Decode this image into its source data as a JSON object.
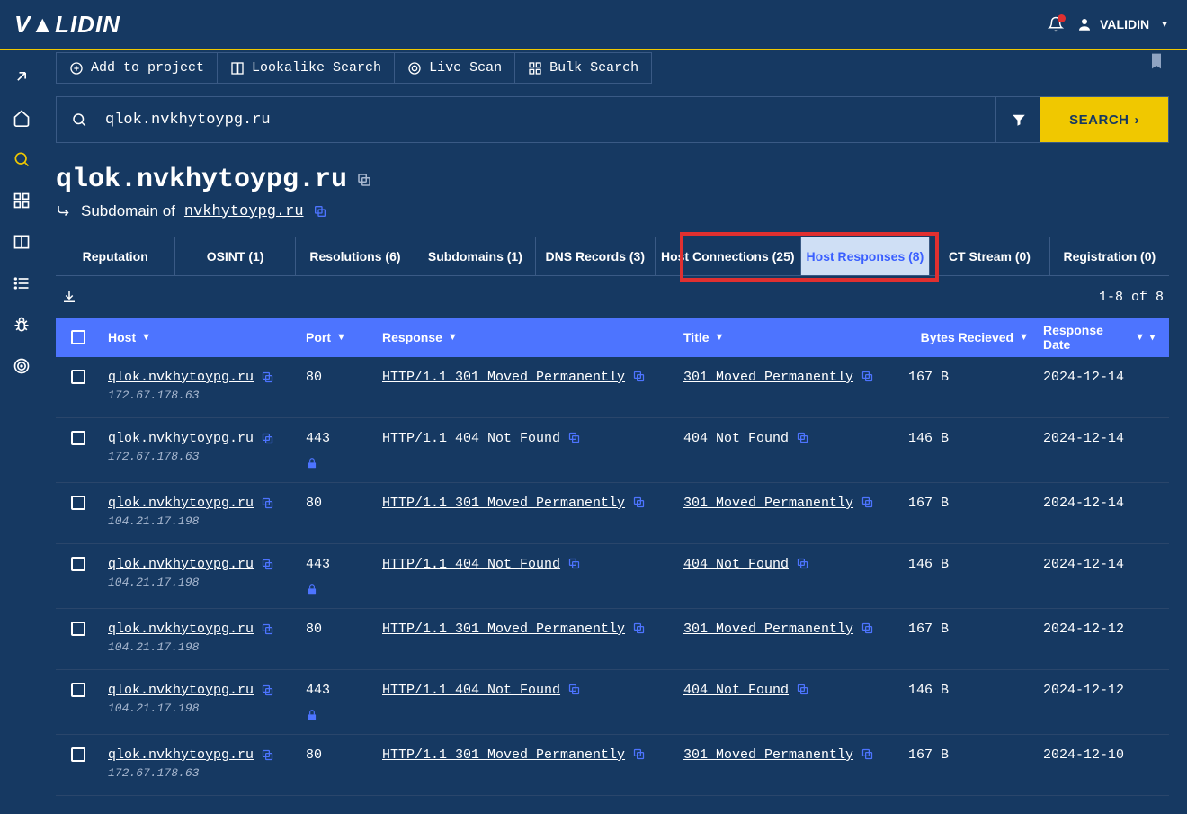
{
  "header": {
    "logo": "V▲LIDIN",
    "user": "VALIDIN"
  },
  "toolbar": {
    "add_to_project": "Add to project",
    "lookalike": "Lookalike Search",
    "live_scan": "Live Scan",
    "bulk_search": "Bulk Search"
  },
  "search": {
    "value": "qlok.nvkhytoypg.ru",
    "button": "SEARCH"
  },
  "title": {
    "host": "qlok.nvkhytoypg.ru",
    "subdomain_prefix": "Subdomain of",
    "parent": "nvkhytoypg.ru"
  },
  "tabs": [
    {
      "label": "Reputation"
    },
    {
      "label": "OSINT (1)"
    },
    {
      "label": "Resolutions (6)"
    },
    {
      "label": "Subdomains (1)"
    },
    {
      "label": "DNS Records (3)"
    },
    {
      "label": "Host Connections (25)"
    },
    {
      "label": "Host Responses (8)"
    },
    {
      "label": "CT Stream (0)"
    },
    {
      "label": "Registration (0)"
    }
  ],
  "pagination": "1-8 of 8",
  "columns": {
    "host": "Host",
    "port": "Port",
    "response": "Response",
    "title": "Title",
    "bytes": "Bytes Recieved",
    "date": "Response Date"
  },
  "rows": [
    {
      "host": "qlok.nvkhytoypg.ru",
      "ip": "172.67.178.63",
      "port": "80",
      "secure": false,
      "response": "HTTP/1.1 301 Moved Permanently",
      "title": "301 Moved Permanently",
      "bytes": "167 B",
      "date": "2024-12-14"
    },
    {
      "host": "qlok.nvkhytoypg.ru",
      "ip": "172.67.178.63",
      "port": "443",
      "secure": true,
      "response": "HTTP/1.1 404 Not Found",
      "title": "404 Not Found",
      "bytes": "146 B",
      "date": "2024-12-14"
    },
    {
      "host": "qlok.nvkhytoypg.ru",
      "ip": "104.21.17.198",
      "port": "80",
      "secure": false,
      "response": "HTTP/1.1 301 Moved Permanently",
      "title": "301 Moved Permanently",
      "bytes": "167 B",
      "date": "2024-12-14"
    },
    {
      "host": "qlok.nvkhytoypg.ru",
      "ip": "104.21.17.198",
      "port": "443",
      "secure": true,
      "response": "HTTP/1.1 404 Not Found",
      "title": "404 Not Found",
      "bytes": "146 B",
      "date": "2024-12-14"
    },
    {
      "host": "qlok.nvkhytoypg.ru",
      "ip": "104.21.17.198",
      "port": "80",
      "secure": false,
      "response": "HTTP/1.1 301 Moved Permanently",
      "title": "301 Moved Permanently",
      "bytes": "167 B",
      "date": "2024-12-12"
    },
    {
      "host": "qlok.nvkhytoypg.ru",
      "ip": "104.21.17.198",
      "port": "443",
      "secure": true,
      "response": "HTTP/1.1 404 Not Found",
      "title": "404 Not Found",
      "bytes": "146 B",
      "date": "2024-12-12"
    },
    {
      "host": "qlok.nvkhytoypg.ru",
      "ip": "172.67.178.63",
      "port": "80",
      "secure": false,
      "response": "HTTP/1.1 301 Moved Permanently",
      "title": "301 Moved Permanently",
      "bytes": "167 B",
      "date": "2024-12-10"
    }
  ]
}
